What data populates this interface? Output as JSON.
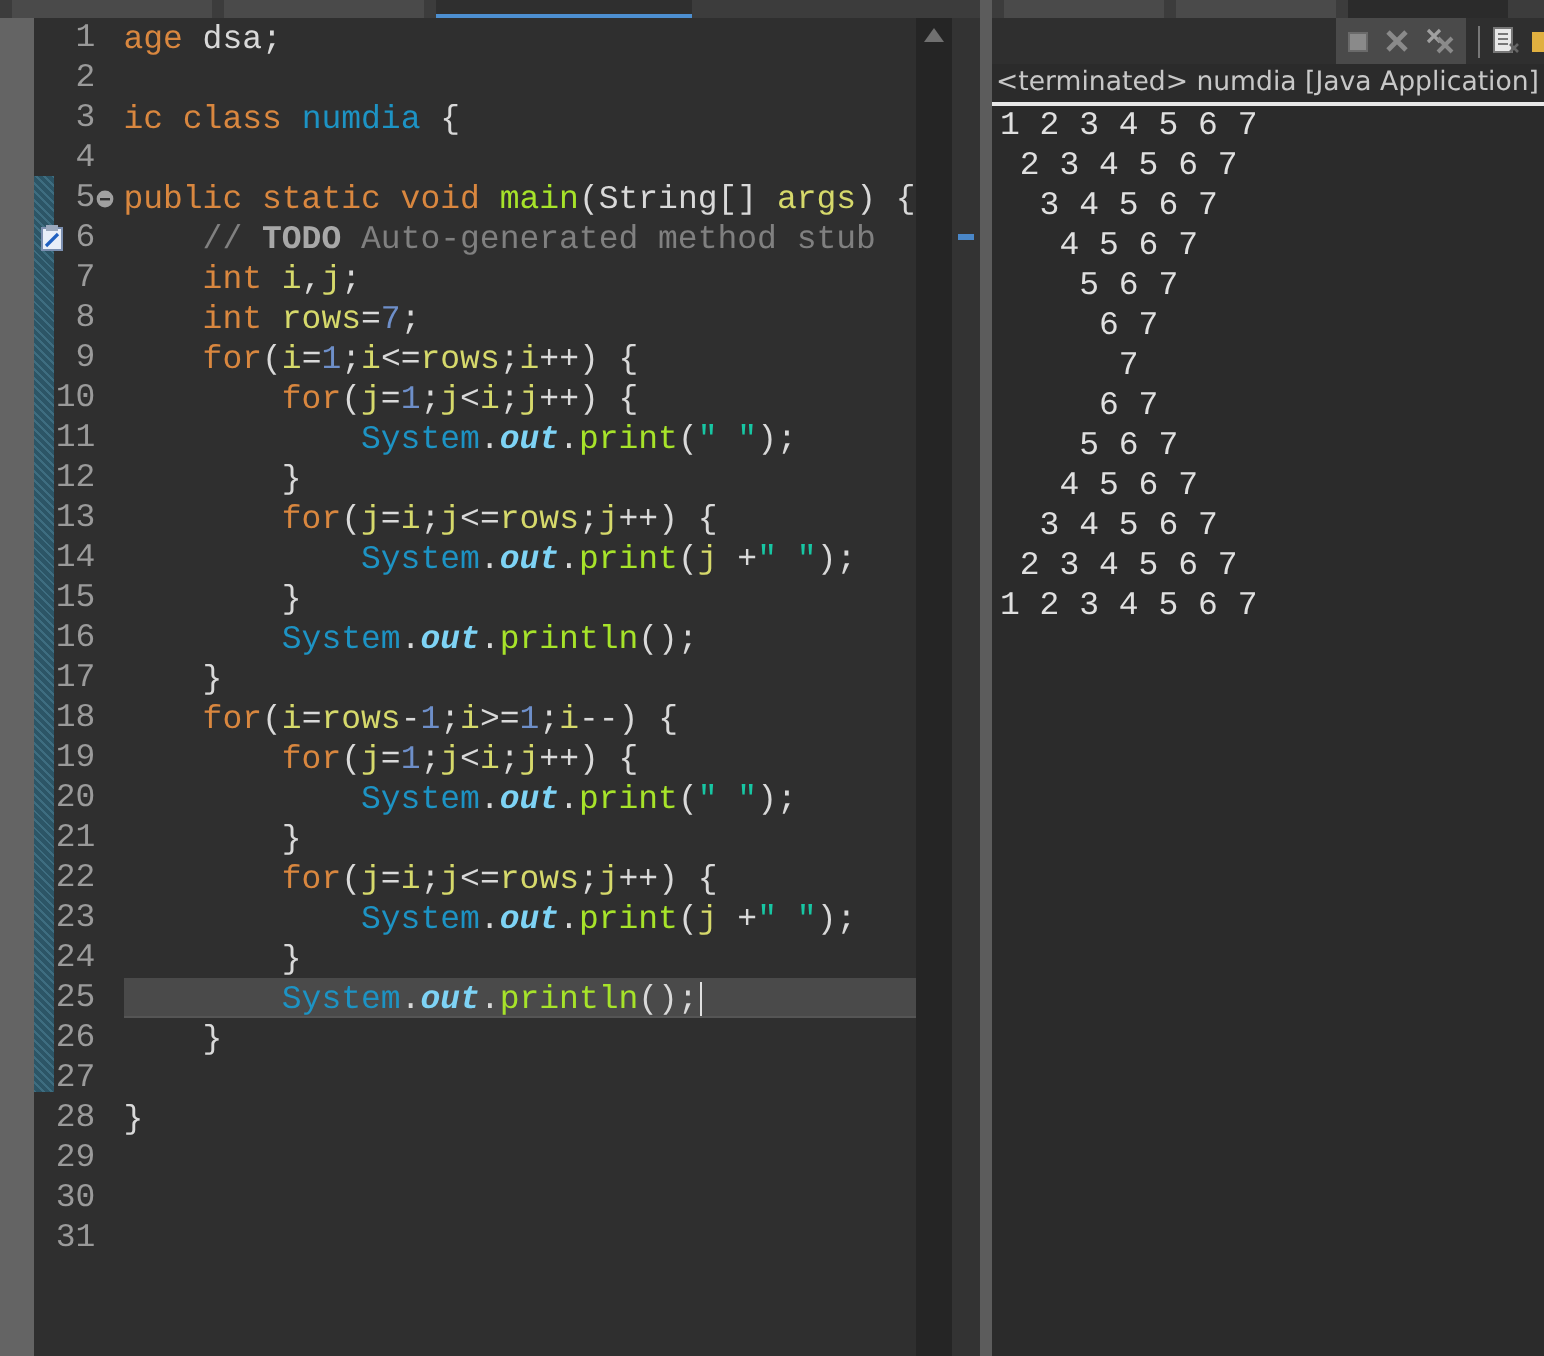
{
  "editor_tabs": [
    {
      "selected": false
    },
    {
      "selected": false
    },
    {
      "selected": true
    }
  ],
  "view_tabs": [
    {
      "selected": false
    },
    {
      "selected": false
    },
    {
      "selected": true
    }
  ],
  "editor": {
    "lines": [
      {
        "number": "1",
        "kind": "code",
        "current": false,
        "tokens": [
          {
            "kind": "kw",
            "text": "age"
          },
          {
            "kind": "plain",
            "text": " dsa;"
          }
        ]
      },
      {
        "number": "2",
        "kind": "code",
        "current": false
      },
      {
        "number": "3",
        "kind": "code",
        "current": false,
        "tokens": [
          {
            "kind": "kw",
            "text": "ic class "
          },
          {
            "kind": "cls",
            "text": "numdia"
          },
          {
            "kind": "plain",
            "text": " {"
          }
        ]
      },
      {
        "number": "4",
        "kind": "code",
        "current": false
      },
      {
        "number": "5",
        "kind": "fold",
        "current": false,
        "tokens": [
          {
            "kind": "kw",
            "text": "public static void "
          },
          {
            "kind": "method",
            "text": "main"
          },
          {
            "kind": "plain",
            "text": "(String[] "
          },
          {
            "kind": "var",
            "text": "args"
          },
          {
            "kind": "plain",
            "text": ") {"
          }
        ]
      },
      {
        "number": "6",
        "kind": "task",
        "current": false,
        "tokens": [
          {
            "kind": "comment",
            "text": "    // "
          },
          {
            "kind": "todo",
            "text": "TODO"
          },
          {
            "kind": "comment",
            "text": " Auto-generated method stub"
          }
        ]
      },
      {
        "number": "7",
        "kind": "code",
        "current": false,
        "tokens": [
          {
            "kind": "kw",
            "text": "    int "
          },
          {
            "kind": "var",
            "text": "i"
          },
          {
            "kind": "plain",
            "text": ","
          },
          {
            "kind": "var",
            "text": "j"
          },
          {
            "kind": "plain",
            "text": ";"
          }
        ]
      },
      {
        "number": "8",
        "kind": "code",
        "current": false,
        "tokens": [
          {
            "kind": "kw",
            "text": "    int "
          },
          {
            "kind": "var",
            "text": "rows"
          },
          {
            "kind": "plain",
            "text": "="
          },
          {
            "kind": "num",
            "text": "7"
          },
          {
            "kind": "plain",
            "text": ";"
          }
        ]
      },
      {
        "number": "9",
        "kind": "code",
        "current": false,
        "tokens": [
          {
            "kind": "kw",
            "text": "    for"
          },
          {
            "kind": "plain",
            "text": "("
          },
          {
            "kind": "var",
            "text": "i"
          },
          {
            "kind": "plain",
            "text": "="
          },
          {
            "kind": "num",
            "text": "1"
          },
          {
            "kind": "plain",
            "text": ";"
          },
          {
            "kind": "var",
            "text": "i"
          },
          {
            "kind": "plain",
            "text": "<="
          },
          {
            "kind": "var",
            "text": "rows"
          },
          {
            "kind": "plain",
            "text": ";"
          },
          {
            "kind": "var",
            "text": "i"
          },
          {
            "kind": "plain",
            "text": "++) {"
          }
        ]
      },
      {
        "number": "10",
        "kind": "code",
        "current": false,
        "tokens": [
          {
            "kind": "kw",
            "text": "        for"
          },
          {
            "kind": "plain",
            "text": "("
          },
          {
            "kind": "var",
            "text": "j"
          },
          {
            "kind": "plain",
            "text": "="
          },
          {
            "kind": "num",
            "text": "1"
          },
          {
            "kind": "plain",
            "text": ";"
          },
          {
            "kind": "var",
            "text": "j"
          },
          {
            "kind": "plain",
            "text": "<"
          },
          {
            "kind": "var",
            "text": "i"
          },
          {
            "kind": "plain",
            "text": ";"
          },
          {
            "kind": "var",
            "text": "j"
          },
          {
            "kind": "plain",
            "text": "++) {"
          }
        ]
      },
      {
        "number": "11",
        "kind": "code",
        "current": false,
        "tokens": [
          {
            "kind": "cls",
            "text": "            System"
          },
          {
            "kind": "plain",
            "text": "."
          },
          {
            "kind": "field",
            "text": "out"
          },
          {
            "kind": "plain",
            "text": "."
          },
          {
            "kind": "method",
            "text": "print"
          },
          {
            "kind": "plain",
            "text": "("
          },
          {
            "kind": "str",
            "text": "\" \""
          },
          {
            "kind": "plain",
            "text": ");"
          }
        ]
      },
      {
        "number": "12",
        "kind": "code",
        "current": false,
        "tokens": [
          {
            "kind": "plain",
            "text": "        }"
          }
        ]
      },
      {
        "number": "13",
        "kind": "code",
        "current": false,
        "tokens": [
          {
            "kind": "kw",
            "text": "        for"
          },
          {
            "kind": "plain",
            "text": "("
          },
          {
            "kind": "var",
            "text": "j"
          },
          {
            "kind": "plain",
            "text": "="
          },
          {
            "kind": "var",
            "text": "i"
          },
          {
            "kind": "plain",
            "text": ";"
          },
          {
            "kind": "var",
            "text": "j"
          },
          {
            "kind": "plain",
            "text": "<="
          },
          {
            "kind": "var",
            "text": "rows"
          },
          {
            "kind": "plain",
            "text": ";"
          },
          {
            "kind": "var",
            "text": "j"
          },
          {
            "kind": "plain",
            "text": "++) {"
          }
        ]
      },
      {
        "number": "14",
        "kind": "code",
        "current": false,
        "tokens": [
          {
            "kind": "cls",
            "text": "            System"
          },
          {
            "kind": "plain",
            "text": "."
          },
          {
            "kind": "field",
            "text": "out"
          },
          {
            "kind": "plain",
            "text": "."
          },
          {
            "kind": "method",
            "text": "print"
          },
          {
            "kind": "plain",
            "text": "("
          },
          {
            "kind": "var",
            "text": "j"
          },
          {
            "kind": "plain",
            "text": " +"
          },
          {
            "kind": "str",
            "text": "\" \""
          },
          {
            "kind": "plain",
            "text": ");"
          }
        ]
      },
      {
        "number": "15",
        "kind": "code",
        "current": false,
        "tokens": [
          {
            "kind": "plain",
            "text": "        }"
          }
        ]
      },
      {
        "number": "16",
        "kind": "code",
        "current": false,
        "tokens": [
          {
            "kind": "cls",
            "text": "        System"
          },
          {
            "kind": "plain",
            "text": "."
          },
          {
            "kind": "field",
            "text": "out"
          },
          {
            "kind": "plain",
            "text": "."
          },
          {
            "kind": "method",
            "text": "println"
          },
          {
            "kind": "plain",
            "text": "();"
          }
        ]
      },
      {
        "number": "17",
        "kind": "code",
        "current": false,
        "tokens": [
          {
            "kind": "plain",
            "text": "    }"
          }
        ]
      },
      {
        "number": "18",
        "kind": "code",
        "current": false,
        "tokens": [
          {
            "kind": "kw",
            "text": "    for"
          },
          {
            "kind": "plain",
            "text": "("
          },
          {
            "kind": "var",
            "text": "i"
          },
          {
            "kind": "plain",
            "text": "="
          },
          {
            "kind": "var",
            "text": "rows"
          },
          {
            "kind": "plain",
            "text": "-"
          },
          {
            "kind": "num",
            "text": "1"
          },
          {
            "kind": "plain",
            "text": ";"
          },
          {
            "kind": "var",
            "text": "i"
          },
          {
            "kind": "plain",
            "text": ">="
          },
          {
            "kind": "num",
            "text": "1"
          },
          {
            "kind": "plain",
            "text": ";"
          },
          {
            "kind": "var",
            "text": "i"
          },
          {
            "kind": "plain",
            "text": "--) {"
          }
        ]
      },
      {
        "number": "19",
        "kind": "code",
        "current": false,
        "tokens": [
          {
            "kind": "kw",
            "text": "        for"
          },
          {
            "kind": "plain",
            "text": "("
          },
          {
            "kind": "var",
            "text": "j"
          },
          {
            "kind": "plain",
            "text": "="
          },
          {
            "kind": "num",
            "text": "1"
          },
          {
            "kind": "plain",
            "text": ";"
          },
          {
            "kind": "var",
            "text": "j"
          },
          {
            "kind": "plain",
            "text": "<"
          },
          {
            "kind": "var",
            "text": "i"
          },
          {
            "kind": "plain",
            "text": ";"
          },
          {
            "kind": "var",
            "text": "j"
          },
          {
            "kind": "plain",
            "text": "++) {"
          }
        ]
      },
      {
        "number": "20",
        "kind": "code",
        "current": false,
        "tokens": [
          {
            "kind": "cls",
            "text": "            System"
          },
          {
            "kind": "plain",
            "text": "."
          },
          {
            "kind": "field",
            "text": "out"
          },
          {
            "kind": "plain",
            "text": "."
          },
          {
            "kind": "method",
            "text": "print"
          },
          {
            "kind": "plain",
            "text": "("
          },
          {
            "kind": "str",
            "text": "\" \""
          },
          {
            "kind": "plain",
            "text": ");"
          }
        ]
      },
      {
        "number": "21",
        "kind": "code",
        "current": false,
        "tokens": [
          {
            "kind": "plain",
            "text": "        }"
          }
        ]
      },
      {
        "number": "22",
        "kind": "code",
        "current": false,
        "tokens": [
          {
            "kind": "kw",
            "text": "        for"
          },
          {
            "kind": "plain",
            "text": "("
          },
          {
            "kind": "var",
            "text": "j"
          },
          {
            "kind": "plain",
            "text": "="
          },
          {
            "kind": "var",
            "text": "i"
          },
          {
            "kind": "plain",
            "text": ";"
          },
          {
            "kind": "var",
            "text": "j"
          },
          {
            "kind": "plain",
            "text": "<="
          },
          {
            "kind": "var",
            "text": "rows"
          },
          {
            "kind": "plain",
            "text": ";"
          },
          {
            "kind": "var",
            "text": "j"
          },
          {
            "kind": "plain",
            "text": "++) {"
          }
        ]
      },
      {
        "number": "23",
        "kind": "code",
        "current": false,
        "tokens": [
          {
            "kind": "cls",
            "text": "            System"
          },
          {
            "kind": "plain",
            "text": "."
          },
          {
            "kind": "field",
            "text": "out"
          },
          {
            "kind": "plain",
            "text": "."
          },
          {
            "kind": "method",
            "text": "print"
          },
          {
            "kind": "plain",
            "text": "("
          },
          {
            "kind": "var",
            "text": "j"
          },
          {
            "kind": "plain",
            "text": " +"
          },
          {
            "kind": "str",
            "text": "\" \""
          },
          {
            "kind": "plain",
            "text": ");"
          }
        ]
      },
      {
        "number": "24",
        "kind": "code",
        "current": false,
        "tokens": [
          {
            "kind": "plain",
            "text": "        }"
          }
        ]
      },
      {
        "number": "25",
        "kind": "code",
        "current": true,
        "tokens": [
          {
            "kind": "cls",
            "text": "        System"
          },
          {
            "kind": "plain",
            "text": "."
          },
          {
            "kind": "field",
            "text": "out"
          },
          {
            "kind": "plain",
            "text": "."
          },
          {
            "kind": "method",
            "text": "println"
          },
          {
            "kind": "plain",
            "text": "();"
          }
        ]
      },
      {
        "number": "26",
        "kind": "code",
        "current": false,
        "tokens": [
          {
            "kind": "plain",
            "text": "    }"
          }
        ]
      },
      {
        "number": "27",
        "kind": "code",
        "current": false
      },
      {
        "number": "28",
        "kind": "code",
        "current": false,
        "tokens": [
          {
            "kind": "plain",
            "text": "}"
          }
        ]
      },
      {
        "number": "29",
        "kind": "code",
        "current": false
      },
      {
        "number": "30",
        "kind": "code",
        "current": false
      },
      {
        "number": "31",
        "kind": "code",
        "current": false
      }
    ]
  },
  "console": {
    "header": "<terminated> numdia [Java Application]",
    "output": [
      "1 2 3 4 5 6 7",
      " 2 3 4 5 6 7",
      "  3 4 5 6 7",
      "   4 5 6 7",
      "    5 6 7",
      "     6 7",
      "      7",
      "     6 7",
      "    5 6 7",
      "   4 5 6 7",
      "  3 4 5 6 7",
      " 2 3 4 5 6 7",
      "1 2 3 4 5 6 7"
    ]
  }
}
